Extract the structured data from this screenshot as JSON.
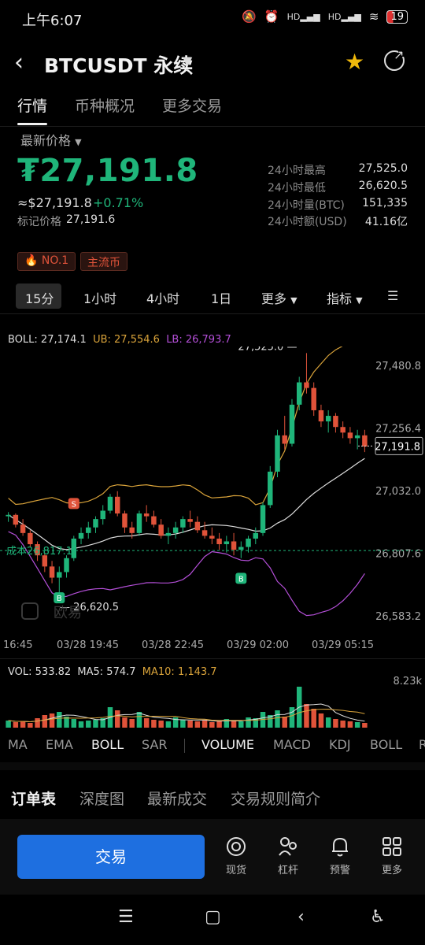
{
  "status": {
    "time": "上午6:07",
    "battery": "19",
    "net1": "HD",
    "net2": "HD"
  },
  "header": {
    "title": "BTCUSDT 永续",
    "star_icon": "star-icon",
    "share_icon": "share-icon"
  },
  "tabs": [
    {
      "label": "行情"
    },
    {
      "label": "币种概况"
    },
    {
      "label": "更多交易"
    }
  ],
  "price": {
    "label": "最新价格",
    "last": "₮27,191.8",
    "usd": "≈$27,191.8",
    "change": "+0.71%",
    "mark_label": "标记价格",
    "mark_value": "27,191.6"
  },
  "stats": [
    {
      "label": "24小时最高",
      "value": "27,525.0"
    },
    {
      "label": "24小时最低",
      "value": "26,620.5"
    },
    {
      "label": "24小时量(BTC)",
      "value": "151,335"
    },
    {
      "label": "24小时额(USD)",
      "value": "41.16亿"
    }
  ],
  "tags": [
    {
      "label": "NO.1"
    },
    {
      "label": "主流币"
    }
  ],
  "intervals": {
    "i15": "15分",
    "i1h": "1小时",
    "i4h": "4小时",
    "i1d": "1日",
    "more": "更多",
    "indicator": "指标"
  },
  "legend": {
    "boll": "BOLL: 27,174.1",
    "ub": "UB: 27,554.6",
    "lb": "LB: 26,793.7"
  },
  "annotations": {
    "high": "27,525.0",
    "low": "26,620.5",
    "cost": "成本26,817.1",
    "watermark": "欧易",
    "current": "27,191.8",
    "s_marker": "S",
    "b_marker": "B"
  },
  "axis": {
    "price_ticks": [
      "27,480.8",
      "27,256.4",
      "27,032.0",
      "26,807.6",
      "26,583.2"
    ],
    "time_ticks": [
      "16:45",
      "03/28 19:45",
      "03/28 22:45",
      "03/29 02:00",
      "03/29 05:15"
    ]
  },
  "volume": {
    "vol": "VOL: 533.82",
    "ma5": "MA5: 574.7",
    "ma10": "MA10: 1,143.7",
    "max": "8.23k"
  },
  "indicators": [
    "MA",
    "EMA",
    "BOLL",
    "SAR",
    "VOLUME",
    "MACD",
    "KDJ",
    "BOLL",
    "R"
  ],
  "book_tabs": [
    "订单表",
    "深度图",
    "最新成交",
    "交易规则简介"
  ],
  "bottom": {
    "trade": "交易",
    "items": [
      {
        "label": "现货",
        "icon": "spot-icon"
      },
      {
        "label": "杠杆",
        "icon": "margin-icon"
      },
      {
        "label": "预警",
        "icon": "bell-icon"
      },
      {
        "label": "更多",
        "icon": "grid-icon"
      }
    ]
  },
  "colors": {
    "up": "#1fb57a",
    "down": "#e0533a",
    "ub": "#d9a33a",
    "lb": "#b44fd8",
    "mid": "#dddddd",
    "accent": "#1e6fe0"
  },
  "chart_data": {
    "type": "candlestick",
    "candles": [
      [
        26940,
        26955,
        26920,
        26945
      ],
      [
        26945,
        26950,
        26900,
        26910
      ],
      [
        26910,
        26930,
        26870,
        26880
      ],
      [
        26880,
        26890,
        26830,
        26840
      ],
      [
        26840,
        26850,
        26780,
        26800
      ],
      [
        26800,
        26810,
        26740,
        26760
      ],
      [
        26760,
        26780,
        26700,
        26720
      ],
      [
        26720,
        26760,
        26660,
        26740
      ],
      [
        26740,
        26800,
        26720,
        26790
      ],
      [
        26790,
        26870,
        26780,
        26860
      ],
      [
        26860,
        26900,
        26840,
        26880
      ],
      [
        26880,
        26920,
        26860,
        26900
      ],
      [
        26900,
        26940,
        26880,
        26930
      ],
      [
        26930,
        26980,
        26910,
        26960
      ],
      [
        26960,
        27020,
        26950,
        27010
      ],
      [
        27010,
        27030,
        26940,
        26950
      ],
      [
        26950,
        26960,
        26880,
        26900
      ],
      [
        26900,
        26920,
        26860,
        26880
      ],
      [
        26880,
        26960,
        26870,
        26950
      ],
      [
        26950,
        26980,
        26920,
        26940
      ],
      [
        26940,
        26960,
        26900,
        26910
      ],
      [
        26910,
        26930,
        26860,
        26870
      ],
      [
        26870,
        26900,
        26840,
        26880
      ],
      [
        26880,
        26920,
        26860,
        26900
      ],
      [
        26900,
        26940,
        26880,
        26930
      ],
      [
        26930,
        26960,
        26900,
        26920
      ],
      [
        26920,
        26940,
        26880,
        26890
      ],
      [
        26890,
        26920,
        26860,
        26870
      ],
      [
        26870,
        26900,
        26840,
        26860
      ],
      [
        26860,
        26880,
        26820,
        26840
      ],
      [
        26840,
        26870,
        26810,
        26850
      ],
      [
        26850,
        26880,
        26800,
        26820
      ],
      [
        26820,
        26850,
        26790,
        26830
      ],
      [
        26830,
        26870,
        26810,
        26860
      ],
      [
        26860,
        26900,
        26840,
        26880
      ],
      [
        26880,
        26990,
        26870,
        26980
      ],
      [
        26980,
        27120,
        26970,
        27100
      ],
      [
        27100,
        27250,
        27080,
        27230
      ],
      [
        27230,
        27300,
        27180,
        27200
      ],
      [
        27200,
        27360,
        27190,
        27340
      ],
      [
        27340,
        27440,
        27320,
        27420
      ],
      [
        27420,
        27525,
        27380,
        27400
      ],
      [
        27400,
        27420,
        27300,
        27320
      ],
      [
        27320,
        27340,
        27260,
        27280
      ],
      [
        27280,
        27320,
        27240,
        27300
      ],
      [
        27300,
        27310,
        27240,
        27260
      ],
      [
        27260,
        27280,
        27220,
        27240
      ],
      [
        27240,
        27260,
        27200,
        27220
      ],
      [
        27220,
        27250,
        27180,
        27230
      ],
      [
        27230,
        27250,
        27170,
        27190
      ]
    ],
    "volumes": [
      0.9,
      0.7,
      0.8,
      0.6,
      1.2,
      1.6,
      1.8,
      2.0,
      1.4,
      1.1,
      0.8,
      0.9,
      1.0,
      1.2,
      2.6,
      2.2,
      1.3,
      1.1,
      2.0,
      1.2,
      1.0,
      0.9,
      0.8,
      1.3,
      1.0,
      0.9,
      0.8,
      0.9,
      0.7,
      0.8,
      1.1,
      0.9,
      0.8,
      1.3,
      1.2,
      2.0,
      1.6,
      2.2,
      1.4,
      2.6,
      5.2,
      3.0,
      2.4,
      1.8,
      1.3,
      1.1,
      0.9,
      0.8,
      0.7,
      0.6
    ],
    "ylim": [
      26583.2,
      27480.8
    ],
    "volume_max_label": "8.23k"
  }
}
